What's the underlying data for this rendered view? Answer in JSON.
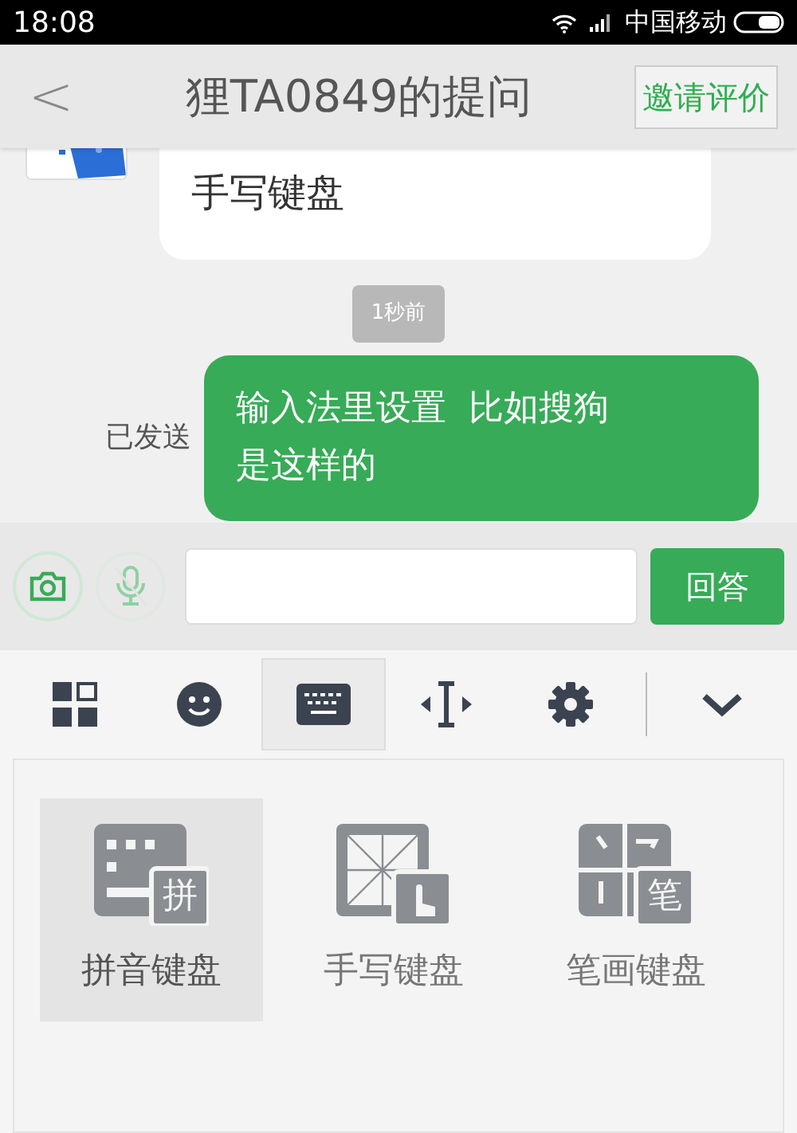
{
  "status_bar": {
    "time": "18:08",
    "carrier": "中国移动"
  },
  "header": {
    "back": "<",
    "title": "狸TA0849的提问",
    "action": "邀请评价"
  },
  "messages": [
    {
      "kind": "received",
      "text": "手写键盘"
    },
    {
      "kind": "time",
      "text": "1秒前"
    },
    {
      "kind": "sent",
      "status": "已发送",
      "lines": [
        "输入法里设置  比如搜狗",
        "是这样的"
      ]
    }
  ],
  "composer": {
    "send": "回答"
  },
  "toolbar": [
    {
      "kind": "grid",
      "selected": false
    },
    {
      "kind": "emoji",
      "selected": false
    },
    {
      "kind": "keyboard",
      "selected": true
    },
    {
      "kind": "cursor",
      "selected": false
    },
    {
      "kind": "settings",
      "selected": false
    },
    {
      "kind": "collapse",
      "selected": false
    }
  ],
  "keyboards": [
    {
      "kind": "pinyin",
      "badge": "拼",
      "label": "拼音键盘",
      "selected": true
    },
    {
      "kind": "handwriting",
      "label": "手写键盘",
      "selected": false
    },
    {
      "kind": "stroke",
      "badge": "笔",
      "label": "笔画键盘",
      "selected": false
    }
  ]
}
